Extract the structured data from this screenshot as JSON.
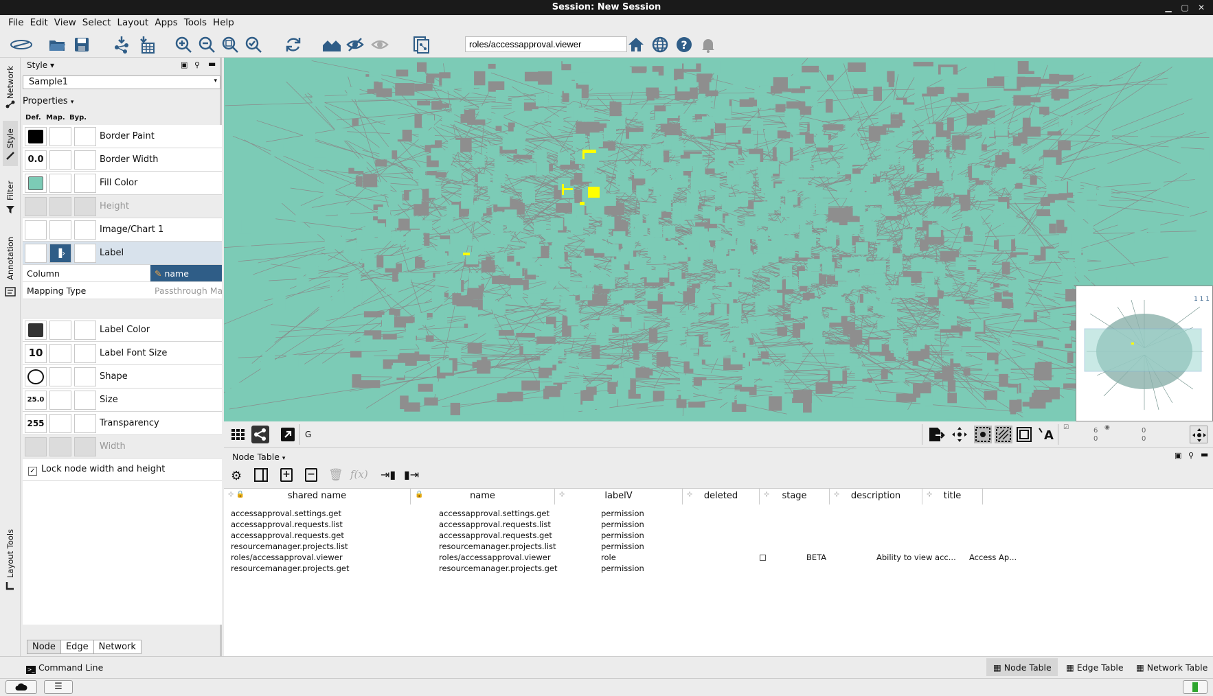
{
  "window": {
    "title": "Session: New Session"
  },
  "menu": [
    "File",
    "Edit",
    "View",
    "Select",
    "Layout",
    "Apps",
    "Tools",
    "Help"
  ],
  "search": {
    "value": "roles/accessapproval.viewer"
  },
  "left_tabs": [
    "Network",
    "Style",
    "Filter",
    "Annotation",
    "Layout Tools"
  ],
  "style_panel": {
    "header": "Style",
    "style_name": "Sample1",
    "properties_label": "Properties",
    "col_def": "Def.",
    "col_map": "Map.",
    "col_byp": "Byp.",
    "border_width_value": "0.0",
    "label_font_size_value": "10",
    "size_value": "25.0",
    "transparency_value": "255",
    "rows": {
      "border_paint": "Border Paint",
      "border_width": "Border Width",
      "fill_color": "Fill Color",
      "height": "Height",
      "image_chart": "Image/Chart 1",
      "label": "Label",
      "label_color": "Label Color",
      "label_font_size": "Label Font Size",
      "shape": "Shape",
      "size": "Size",
      "transparency": "Transparency",
      "width": "Width"
    },
    "mapping": {
      "column_key": "Column",
      "column_value": "name",
      "type_key": "Mapping Type",
      "type_value": "Passthrough Ma"
    },
    "lock_label": "Lock node width and height",
    "tabs": [
      "Node",
      "Edge",
      "Network"
    ]
  },
  "colors": {
    "node_fill": "#7ccbb6",
    "selected_node": "#ffff00",
    "edge": "#8a8a8a",
    "accent": "#2f5d87"
  },
  "canvas": {
    "status_letter": "G",
    "minimap_label": "1 1 1"
  },
  "counters": {
    "nodes_selected": "6",
    "nodes_hidden": "0",
    "edges_selected": "0",
    "edges_hidden": "0"
  },
  "node_table": {
    "header": "Node Table",
    "columns": [
      "shared name",
      "name",
      "labelV",
      "deleted",
      "stage",
      "description",
      "title"
    ],
    "rows": [
      {
        "shared_name": "accessapproval.settings.get",
        "name": "accessapproval.settings.get",
        "labelV": "permission",
        "deleted": "",
        "stage": "",
        "description": "",
        "title": ""
      },
      {
        "shared_name": "accessapproval.requests.list",
        "name": "accessapproval.requests.list",
        "labelV": "permission",
        "deleted": "",
        "stage": "",
        "description": "",
        "title": ""
      },
      {
        "shared_name": "accessapproval.requests.get",
        "name": "accessapproval.requests.get",
        "labelV": "permission",
        "deleted": "",
        "stage": "",
        "description": "",
        "title": ""
      },
      {
        "shared_name": "resourcemanager.projects.list",
        "name": "resourcemanager.projects.list",
        "labelV": "permission",
        "deleted": "",
        "stage": "",
        "description": "",
        "title": ""
      },
      {
        "shared_name": "roles/accessapproval.viewer",
        "name": "roles/accessapproval.viewer",
        "labelV": "role",
        "deleted": "checkbox",
        "stage": "BETA",
        "description": "Ability to view acc...",
        "title": "Access Ap..."
      },
      {
        "shared_name": "resourcemanager.projects.get",
        "name": "resourcemanager.projects.get",
        "labelV": "permission",
        "deleted": "",
        "stage": "",
        "description": "",
        "title": ""
      }
    ]
  },
  "status": {
    "command_line": "Command Line",
    "node_table_tab": "Node Table",
    "edge_table_tab": "Edge Table",
    "network_table_tab": "Network Table"
  }
}
